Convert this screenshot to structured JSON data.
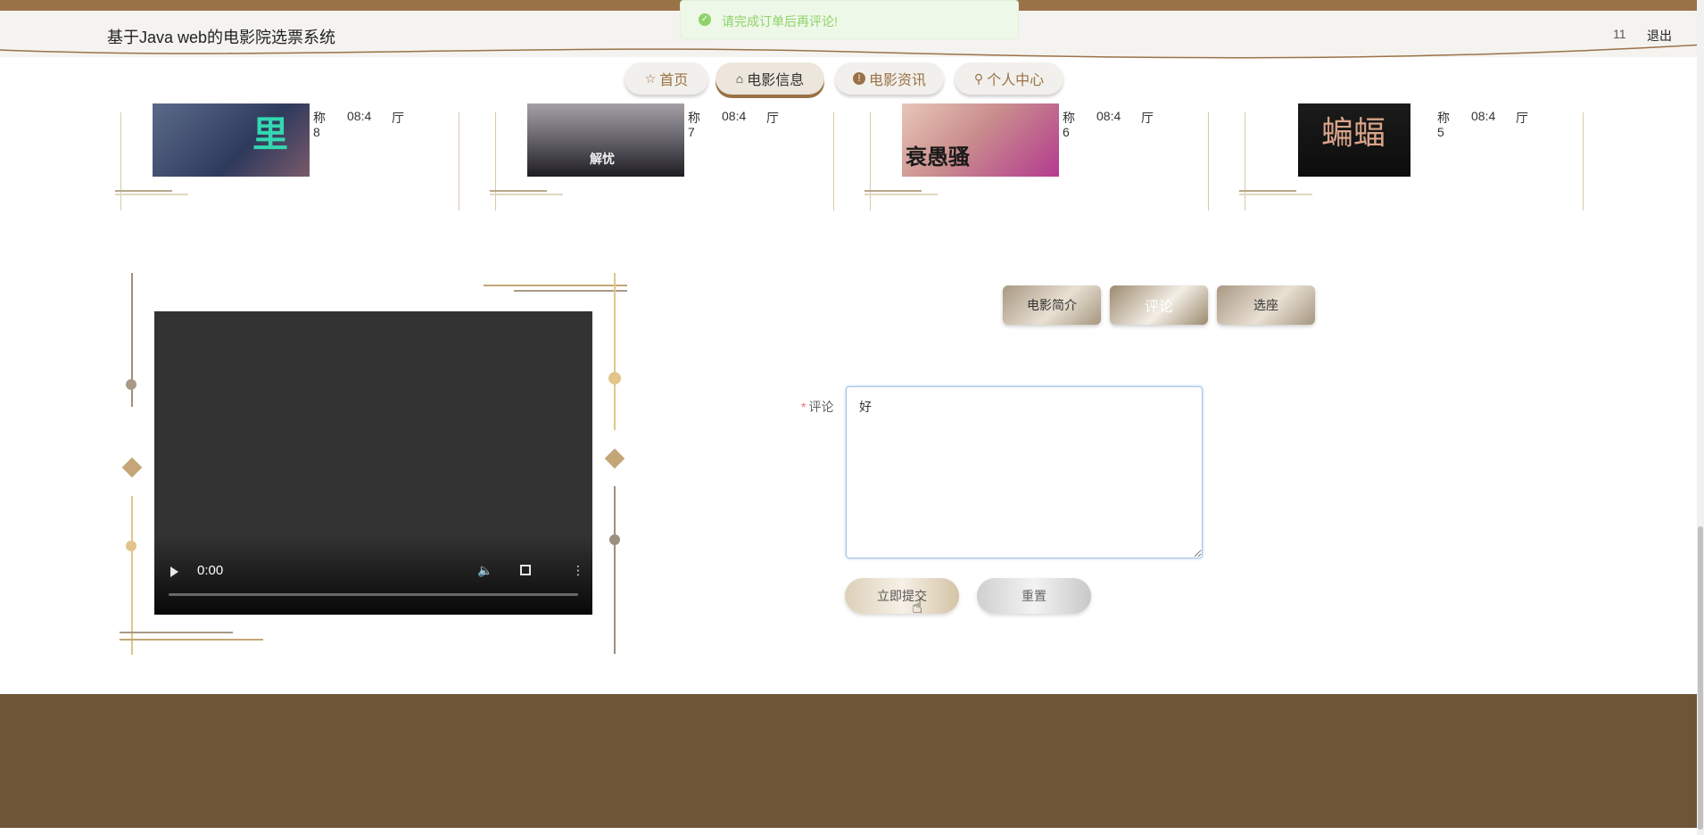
{
  "header": {
    "title": "基于Java web的电影院选票系统",
    "username": "11",
    "logout_label": "退出"
  },
  "toast": {
    "message": "请完成订单后再评论!",
    "icon": "check-circle-icon"
  },
  "nav": {
    "items": [
      {
        "label": "首页",
        "icon": "star-icon"
      },
      {
        "label": "电影信息",
        "icon": "bag-icon",
        "active": true
      },
      {
        "label": "电影资讯",
        "icon": "info-icon"
      },
      {
        "label": "个人中心",
        "icon": "person-icon"
      }
    ]
  },
  "movies": [
    {
      "name_label": "称",
      "number": "8",
      "time": "08:4",
      "hall": "厅",
      "poster_text": "里"
    },
    {
      "name_label": "称",
      "number": "7",
      "time": "08:4",
      "hall": "厅",
      "poster_text": "解忧"
    },
    {
      "name_label": "称",
      "number": "6",
      "time": "08:4",
      "hall": "厅",
      "poster_text": "衰愚骚"
    },
    {
      "name_label": "称",
      "number": "5",
      "time": "08:4",
      "hall": "厅",
      "poster_text": "蝙蝠"
    }
  ],
  "video": {
    "current_time": "0:00",
    "progress": 0
  },
  "tabs": [
    {
      "label": "电影简介"
    },
    {
      "label": "评论",
      "active": true
    },
    {
      "label": "选座"
    }
  ],
  "form": {
    "required_mark": "*",
    "comment_label": "评论",
    "comment_value": "好",
    "submit_label": "立即提交",
    "reset_label": "重置"
  },
  "colors": {
    "brand_brown": "#9a7247",
    "footer": "#6e5538",
    "toast_green": "#8fd26a",
    "accent_gold": "#e3c48a"
  }
}
